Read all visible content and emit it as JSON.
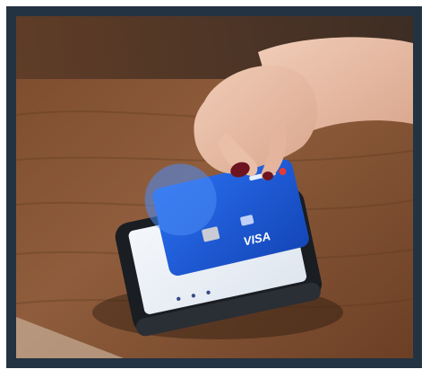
{
  "photo": {
    "subject": "contactless-card-payment",
    "card": {
      "network": "VISA"
    }
  },
  "colors": {
    "frame": "#243342",
    "card_blue": "#1e58d8",
    "table_wood": "#8a5a3a",
    "terminal_body": "#1a1d22"
  }
}
